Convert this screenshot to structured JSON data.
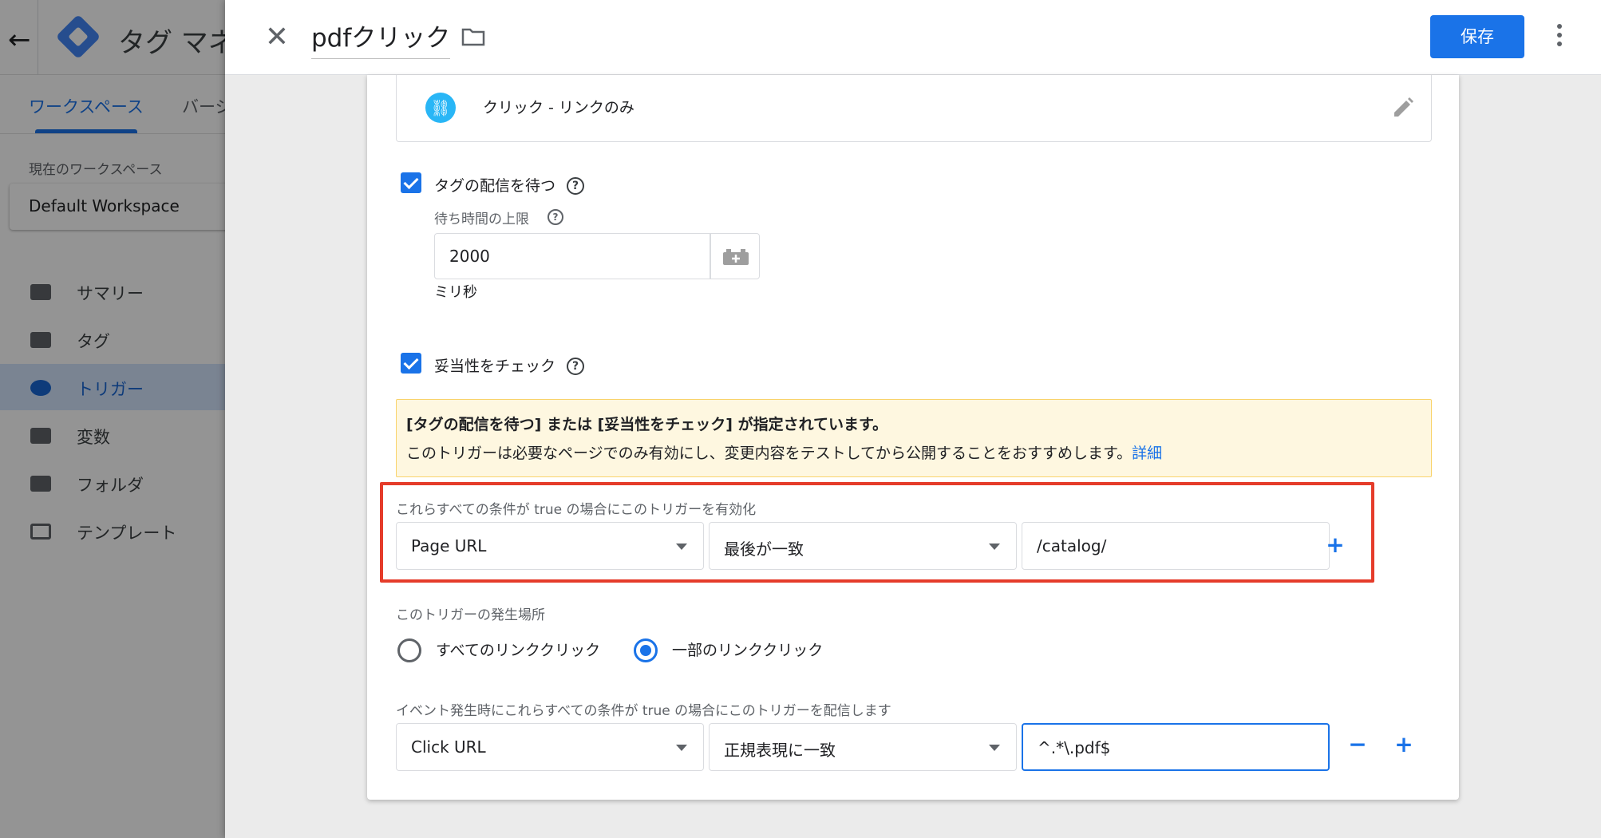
{
  "background": {
    "back_icon": "arrow-left-icon",
    "app_title": "タグ マネ",
    "tabs": [
      "ワークスペース",
      "バージ"
    ],
    "workspace_label": "現在のワークスペース",
    "workspace_name": "Default Workspace",
    "nav": [
      {
        "label": "サマリー",
        "icon": "summary-icon"
      },
      {
        "label": "タグ",
        "icon": "tag-icon"
      },
      {
        "label": "トリガー",
        "icon": "trigger-icon",
        "active": true
      },
      {
        "label": "変数",
        "icon": "variable-icon"
      },
      {
        "label": "フォルダ",
        "icon": "folder-icon"
      },
      {
        "label": "テンプレート",
        "icon": "template-icon"
      }
    ]
  },
  "panel": {
    "title": "pdfクリック",
    "save_label": "保存",
    "trigger_type": "クリック - リンクのみ",
    "wait_for_tags": {
      "label": "タグの配信を待つ",
      "checked": true,
      "limit_label": "待ち時間の上限",
      "value": "2000",
      "unit": "ミリ秒"
    },
    "check_validation": {
      "label": "妥当性をチェック",
      "checked": true
    },
    "warning": {
      "title": "[タグの配信を待つ] または [妥当性をチェック] が指定されています。",
      "body": "このトリガーは必要なページでのみ有効にし、変更内容をテストしてから公開することをおすすめします。",
      "link": "詳細"
    },
    "enable_conditions": {
      "label": "これらすべての条件が true の場合にこのトリガーを有効化",
      "variable": "Page URL",
      "operator": "最後が一致",
      "value": "/catalog/",
      "add": "+"
    },
    "fires_on": {
      "label": "このトリガーの発生場所",
      "options": [
        "すべてのリンククリック",
        "一部のリンククリック"
      ],
      "selected": "一部のリンククリック"
    },
    "fire_conditions": {
      "label": "イベント発生時にこれらすべての条件が true の場合にこのトリガーを配信します",
      "variable": "Click URL",
      "operator": "正規表現に一致",
      "value": "^.*\\.pdf$",
      "remove": "−",
      "add": "+"
    }
  },
  "colors": {
    "accent": "#1a73e8",
    "highlight": "#e53c2a",
    "warning_bg": "#fef7e0"
  }
}
